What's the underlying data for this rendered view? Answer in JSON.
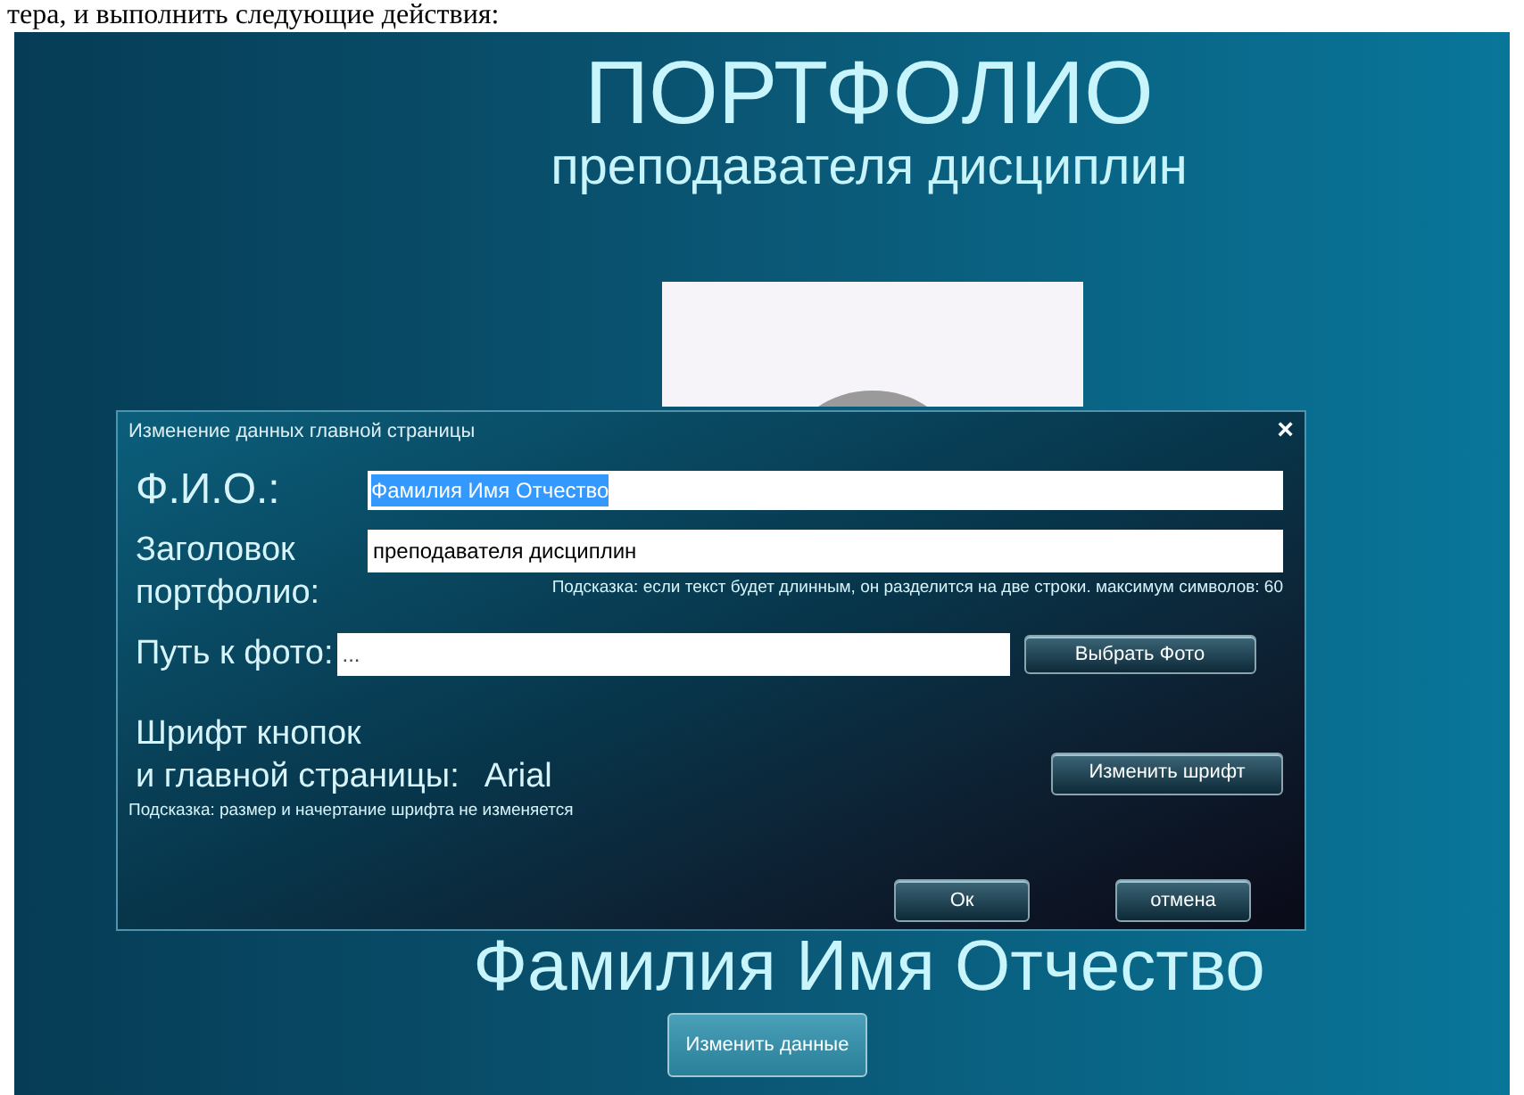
{
  "document_text": "тера, и выполнить следующие действия:",
  "app": {
    "title": "ПОРТФОЛИО",
    "subtitle": "преподавателя дисциплин",
    "name": "Фамилия Имя Отчество",
    "edit_button": "Изменить данные"
  },
  "dialog": {
    "title": "Изменение данных главной страницы",
    "close": "×",
    "fio": {
      "label": "Ф.И.О.:",
      "value": "Фамилия Имя Отчество",
      "selected": true
    },
    "heading": {
      "label_lines": [
        "Заголовок",
        "портфолио:"
      ],
      "value": "преподавателя дисциплин",
      "hint": "Подсказка: если текст будет длинным, он разделится на две строки. максимум символов: 60"
    },
    "photo_path": {
      "label": "Путь к фото:",
      "value": "...",
      "button": "Выбрать Фото"
    },
    "font": {
      "label_lines": [
        "Шрифт кнопок",
        "и главной страницы:"
      ],
      "value": "Arial",
      "hint": "Подсказка: размер и начертание шрифта не изменяется",
      "button": "Изменить шрифт"
    },
    "buttons": [
      "Ок",
      "отмена"
    ]
  }
}
